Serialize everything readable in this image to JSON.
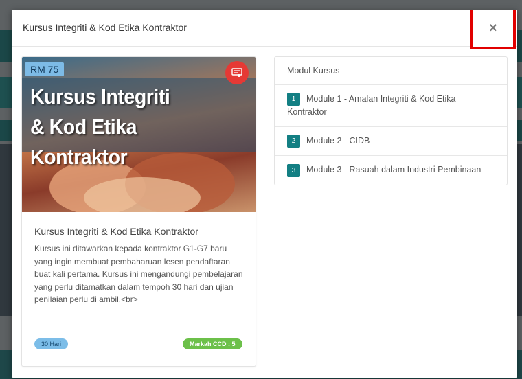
{
  "modal": {
    "title": "Kursus Integriti & Kod Etika Kontraktor",
    "close_label": "×"
  },
  "course_card": {
    "price": "RM 75",
    "banner_line1": "Kursus Integriti",
    "banner_line2": "& Kod Etika Kontraktor",
    "title": "Kursus Integriti & Kod Etika Kontraktor",
    "description": "Kursus ini ditawarkan kepada kontraktor G1-G7 baru yang ingin membuat pembaharuan lesen pendaftaran buat kali pertama. Kursus ini mengandungi pembelajaran yang perlu ditamatkan dalam tempoh 30 hari dan ujian penilaian perlu di ambil.<br>",
    "duration": "30 Hari",
    "ccd_points": "Markah CCD : 5",
    "certificate_icon": "certificate-icon"
  },
  "modules": {
    "header": "Modul Kursus",
    "items": [
      {
        "number": "1",
        "label": "Module 1 - Amalan Integriti & Kod Etika Kontraktor"
      },
      {
        "number": "2",
        "label": "Module 2 - CIDB"
      },
      {
        "number": "3",
        "label": "Module 3 - Rasuah dalam Industri Pembinaan"
      }
    ]
  },
  "colors": {
    "accent_teal": "#137f83",
    "price_badge": "#7dbbe6",
    "ccd_badge": "#6cc04a",
    "close_highlight": "#e10000"
  }
}
